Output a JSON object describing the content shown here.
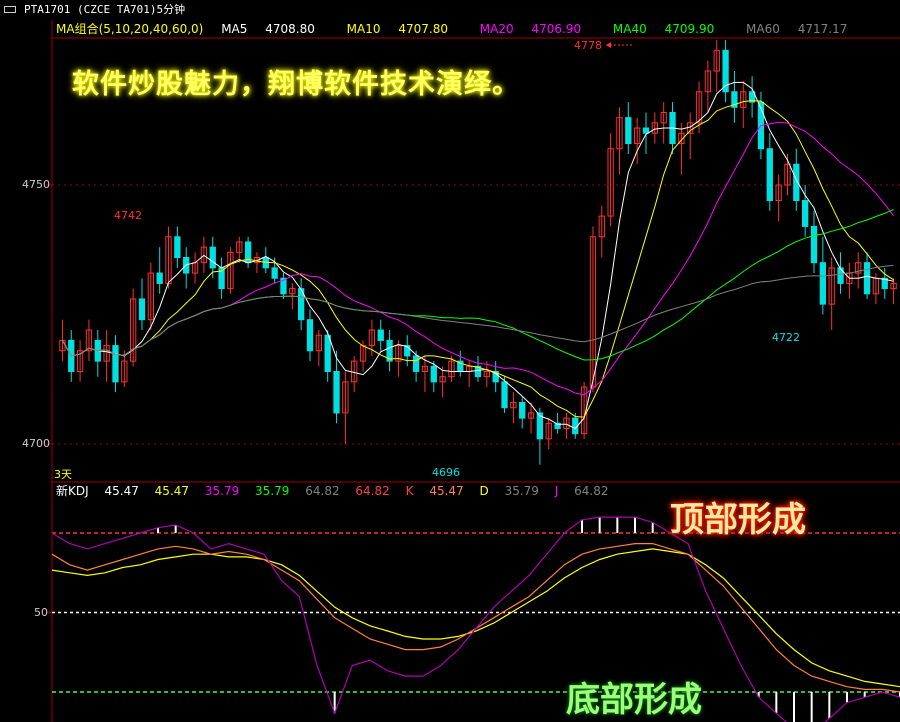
{
  "window": {
    "title": "PTA1701 (CZCE TA701)5分钟"
  },
  "ma_header": {
    "label": "MA组合(5,10,20,40,60,0)",
    "items": [
      {
        "name": "MA5",
        "value": "4708.80",
        "color": "#ffffff"
      },
      {
        "name": "MA10",
        "value": "4707.80",
        "color": "#ffff00"
      },
      {
        "name": "MA20",
        "value": "4706.90",
        "color": "#ff00ff"
      },
      {
        "name": "MA40",
        "value": "4709.90",
        "color": "#00ff00"
      },
      {
        "name": "MA60",
        "value": "4717.17",
        "color": "#808080"
      }
    ]
  },
  "kdj_header": {
    "label": "新KDJ",
    "items": [
      {
        "text": "45.47",
        "color": "#ffffff"
      },
      {
        "text": "45.47",
        "color": "#ffff00"
      },
      {
        "text": "35.79",
        "color": "#ff00ff"
      },
      {
        "text": "35.79",
        "color": "#00ff00"
      },
      {
        "text": "64.82",
        "color": "#808080"
      },
      {
        "text": "64.82",
        "color": "#ff4040"
      },
      {
        "text": "K",
        "color": "#ff4040"
      },
      {
        "text": "45.47",
        "color": "#ff8040"
      },
      {
        "text": "D",
        "color": "#ffff00"
      },
      {
        "text": "35.79",
        "color": "#808080"
      },
      {
        "text": "J",
        "color": "#ff00ff"
      },
      {
        "text": "64.82",
        "color": "#808080"
      }
    ]
  },
  "annotations": {
    "promo": "软件炒股魅力，翔博软件技术演绎。",
    "top_formation": "顶部形成",
    "bottom_formation": "底部形成",
    "high_label": "4778",
    "peak_left_label": "4742",
    "low_label": "4696",
    "low_right_label": "4722",
    "period_label": "3天"
  },
  "axes": {
    "price_ticks": [
      "4750",
      "4700"
    ],
    "kdj_ticks": [
      "50"
    ]
  },
  "colors": {
    "up": "#ff3030",
    "down": "#00e0e0",
    "ma5": "#ffffff",
    "ma10": "#ffff00",
    "ma20": "#ff00ff",
    "ma40": "#00ff00",
    "ma60": "#808080",
    "k_line": "#ffffff",
    "d_line": "#ffff00",
    "j_line": "#b000b0"
  },
  "chart_data": {
    "type": "candlestick",
    "price_ylim": [
      4696,
      4778
    ],
    "price_ticks": [
      4700,
      4750
    ],
    "candles": [
      [
        4718,
        4724,
        4716,
        4720
      ],
      [
        4720,
        4722,
        4712,
        4714
      ],
      [
        4714,
        4720,
        4712,
        4718
      ],
      [
        4718,
        4724,
        4716,
        4722
      ],
      [
        4720,
        4722,
        4713,
        4716
      ],
      [
        4716,
        4722,
        4712,
        4719
      ],
      [
        4719,
        4721,
        4710,
        4712
      ],
      [
        4712,
        4718,
        4711,
        4716
      ],
      [
        4716,
        4730,
        4715,
        4728
      ],
      [
        4728,
        4732,
        4722,
        4724
      ],
      [
        4724,
        4735,
        4722,
        4733
      ],
      [
        4733,
        4738,
        4729,
        4731
      ],
      [
        4731,
        4742,
        4730,
        4740
      ],
      [
        4740,
        4742,
        4734,
        4736
      ],
      [
        4736,
        4738,
        4730,
        4733
      ],
      [
        4733,
        4737,
        4731,
        4735
      ],
      [
        4735,
        4740,
        4733,
        4738
      ],
      [
        4738,
        4740,
        4732,
        4734
      ],
      [
        4734,
        4736,
        4728,
        4730
      ],
      [
        4730,
        4738,
        4729,
        4737
      ],
      [
        4737,
        4740,
        4735,
        4739
      ],
      [
        4739,
        4740,
        4734,
        4735
      ],
      [
        4735,
        4737,
        4733,
        4736
      ],
      [
        4736,
        4738,
        4733,
        4734
      ],
      [
        4734,
        4736,
        4731,
        4732
      ],
      [
        4732,
        4733,
        4728,
        4729
      ],
      [
        4729,
        4731,
        4726,
        4730
      ],
      [
        4730,
        4732,
        4722,
        4724
      ],
      [
        4724,
        4726,
        4716,
        4718
      ],
      [
        4718,
        4722,
        4715,
        4721
      ],
      [
        4721,
        4722,
        4712,
        4714
      ],
      [
        4714,
        4718,
        4704,
        4706
      ],
      [
        4706,
        4714,
        4700,
        4712
      ],
      [
        4712,
        4717,
        4710,
        4716
      ],
      [
        4716,
        4720,
        4714,
        4719
      ],
      [
        4719,
        4724,
        4717,
        4722
      ],
      [
        4722,
        4724,
        4718,
        4720
      ],
      [
        4720,
        4722,
        4714,
        4716
      ],
      [
        4716,
        4720,
        4713,
        4719
      ],
      [
        4719,
        4721,
        4715,
        4717
      ],
      [
        4717,
        4718,
        4712,
        4714
      ],
      [
        4714,
        4717,
        4710,
        4715
      ],
      [
        4715,
        4716,
        4710,
        4712
      ],
      [
        4712,
        4715,
        4709,
        4713
      ],
      [
        4713,
        4717,
        4712,
        4716
      ],
      [
        4716,
        4718,
        4713,
        4714
      ],
      [
        4714,
        4716,
        4711,
        4715
      ],
      [
        4715,
        4717,
        4712,
        4713
      ],
      [
        4713,
        4716,
        4711,
        4714
      ],
      [
        4714,
        4716,
        4710,
        4712
      ],
      [
        4712,
        4713,
        4706,
        4707
      ],
      [
        4707,
        4710,
        4704,
        4708
      ],
      [
        4708,
        4709,
        4703,
        4705
      ],
      [
        4705,
        4708,
        4702,
        4706
      ],
      [
        4706,
        4707,
        4696,
        4701
      ],
      [
        4701,
        4705,
        4699,
        4704
      ],
      [
        4704,
        4706,
        4702,
        4703
      ],
      [
        4703,
        4706,
        4701,
        4705
      ],
      [
        4705,
        4706,
        4701,
        4702
      ],
      [
        4702,
        4712,
        4701,
        4711
      ],
      [
        4711,
        4742,
        4710,
        4740
      ],
      [
        4740,
        4746,
        4736,
        4744
      ],
      [
        4744,
        4760,
        4742,
        4757
      ],
      [
        4757,
        4765,
        4752,
        4763
      ],
      [
        4763,
        4766,
        4756,
        4758
      ],
      [
        4758,
        4763,
        4754,
        4761
      ],
      [
        4761,
        4764,
        4756,
        4760
      ],
      [
        4760,
        4764,
        4758,
        4762
      ],
      [
        4762,
        4766,
        4758,
        4764
      ],
      [
        4764,
        4766,
        4756,
        4758
      ],
      [
        4758,
        4762,
        4752,
        4760
      ],
      [
        4760,
        4764,
        4755,
        4762
      ],
      [
        4762,
        4770,
        4760,
        4768
      ],
      [
        4768,
        4774,
        4764,
        4772
      ],
      [
        4772,
        4778,
        4768,
        4776
      ],
      [
        4776,
        4778,
        4766,
        4768
      ],
      [
        4768,
        4772,
        4762,
        4765
      ],
      [
        4765,
        4770,
        4761,
        4768
      ],
      [
        4768,
        4771,
        4763,
        4766
      ],
      [
        4766,
        4768,
        4755,
        4757
      ],
      [
        4757,
        4760,
        4745,
        4747
      ],
      [
        4747,
        4752,
        4743,
        4750
      ],
      [
        4750,
        4756,
        4748,
        4754
      ],
      [
        4754,
        4757,
        4745,
        4747
      ],
      [
        4747,
        4750,
        4740,
        4742
      ],
      [
        4742,
        4745,
        4733,
        4735
      ],
      [
        4735,
        4740,
        4725,
        4727
      ],
      [
        4727,
        4736,
        4722,
        4734
      ],
      [
        4734,
        4737,
        4729,
        4731
      ],
      [
        4731,
        4735,
        4728,
        4733
      ],
      [
        4733,
        4737,
        4730,
        4735
      ],
      [
        4735,
        4737,
        4728,
        4729
      ],
      [
        4729,
        4733,
        4727,
        4732
      ],
      [
        4732,
        4734,
        4728,
        4730
      ],
      [
        4730,
        4732,
        4727,
        4731
      ]
    ],
    "kdj": {
      "ylim": [
        0,
        100
      ],
      "ref_lines": [
        80,
        50,
        20
      ],
      "k": [
        72,
        68,
        66,
        68,
        70,
        72,
        74,
        75,
        74,
        72,
        73,
        72,
        70,
        66,
        62,
        55,
        48,
        44,
        40,
        38,
        36,
        36,
        37,
        40,
        44,
        48,
        52,
        56,
        62,
        68,
        72,
        74,
        75,
        76,
        76,
        74,
        72,
        66,
        60,
        52,
        44,
        36,
        30,
        26,
        24,
        22,
        21,
        21,
        20
      ],
      "d": [
        66,
        65,
        64,
        65,
        67,
        68,
        70,
        71,
        72,
        72,
        71,
        71,
        70,
        68,
        64,
        58,
        52,
        48,
        45,
        43,
        41,
        40,
        40,
        41,
        43,
        46,
        50,
        54,
        58,
        63,
        67,
        70,
        72,
        73,
        74,
        73,
        72,
        68,
        63,
        56,
        49,
        42,
        36,
        31,
        28,
        26,
        24,
        23,
        22
      ],
      "j": [
        80,
        76,
        74,
        76,
        78,
        80,
        82,
        83,
        80,
        74,
        76,
        74,
        72,
        62,
        56,
        30,
        12,
        30,
        32,
        28,
        26,
        26,
        30,
        36,
        44,
        52,
        58,
        64,
        72,
        80,
        85,
        86,
        86,
        86,
        84,
        80,
        76,
        58,
        44,
        30,
        18,
        12,
        6,
        4,
        10,
        16,
        18,
        20,
        18
      ]
    }
  }
}
